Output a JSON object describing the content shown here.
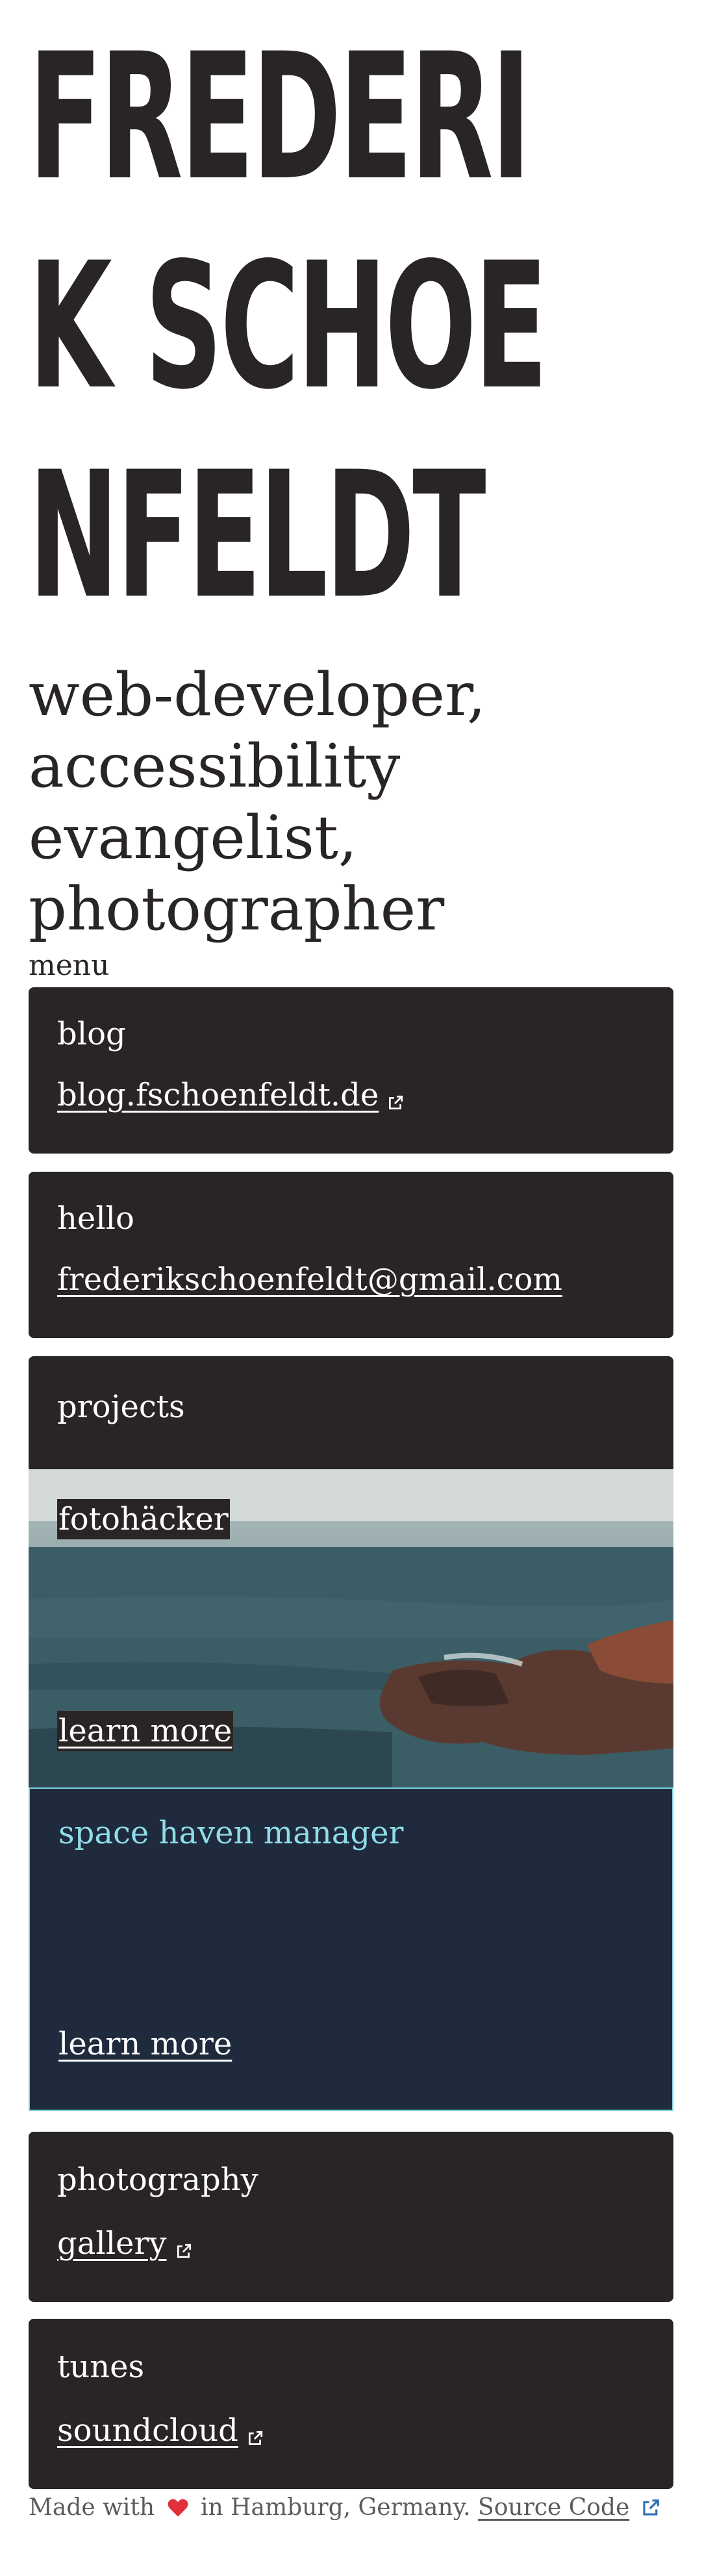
{
  "hero": {
    "name_line1": "FREDERI",
    "name_line2": "K SCHOE",
    "name_line3": "NFELDT",
    "subtitle": "web-developer, accessibility evangelist, photographer"
  },
  "menu": {
    "label": "menu",
    "cards": [
      {
        "label": "blog",
        "link_text": "blog.fschoenfeldt.de",
        "external": true
      },
      {
        "label": "hello",
        "link_text": "frederikschoenfeldt@gmail.com",
        "external": false
      },
      {
        "label": "projects"
      }
    ],
    "projects": [
      {
        "title": "fotohäcker",
        "link_text": "learn more"
      },
      {
        "title": "space haven manager",
        "link_text": "learn more"
      }
    ],
    "cards_after": [
      {
        "label": "photography",
        "link_text": "gallery",
        "external": true
      },
      {
        "label": "tunes",
        "link_text": "soundcloud",
        "external": true
      }
    ]
  },
  "footer": {
    "made_with": "Made with",
    "heart_icon": "heart-icon",
    "location": "in Hamburg, Germany.",
    "source_link": "Source Code"
  },
  "colors": {
    "card_bg": "#2a2525",
    "space_card_bg": "#1f2a3d",
    "space_card_accent": "#8fdde9",
    "heart": "#e0303a"
  }
}
